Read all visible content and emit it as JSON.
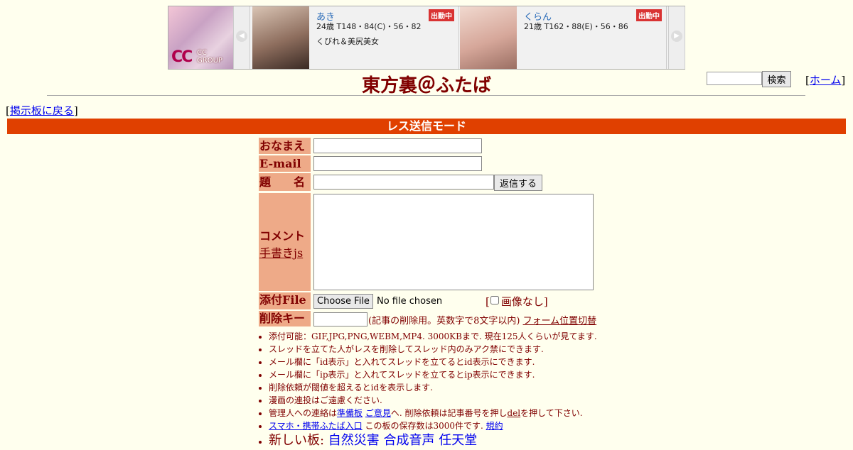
{
  "ad": {
    "logo_text": "CC GROUP",
    "cards": [
      {
        "name": "あき",
        "stats": "24歳 T148・84(C)・56・82",
        "desc": "くびれ＆美尻美女",
        "badge": "出勤中"
      },
      {
        "name": "くらん",
        "stats": "21歳 T162・88(E)・56・86",
        "desc": "",
        "badge": "出勤中"
      }
    ]
  },
  "header": {
    "title": "東方裏＠ふたば",
    "search_button": "検索",
    "home_link": "ホーム",
    "back_link": "掲示板に戻る"
  },
  "mode_bar": "レス送信モード",
  "form": {
    "name_label": "おなまえ",
    "email_label": "E-mail",
    "subject_label": "題　　名",
    "reply_button": "返信する",
    "comment_label": "コメント",
    "handwrite_link": "手書きjs",
    "file_label": "添付File",
    "choose_button": "Choose File",
    "no_file": "No file chosen",
    "no_image": "画像なし",
    "delkey_label": "削除キー",
    "delkey_note": "(記事の削除用。英数字で8文字以内)",
    "form_switch": "フォーム位置切替"
  },
  "notes": {
    "n1": "添付可能：GIF,JPG,PNG,WEBM,MP4. 3000KBまで. 現在125人くらいが見てます.",
    "n2": "スレッドを立てた人がレスを削除してスレッド内のみアク禁にできます.",
    "n3": "メール欄に「id表示」と入れてスレッドを立てるとid表示にできます.",
    "n4": "メール欄に「ip表示」と入れてスレッドを立てるとip表示にできます.",
    "n5": "削除依頼が閾値を超えるとidを表示します.",
    "n6": "漫画の連投はご遠慮ください.",
    "n7_pre": "管理人への連絡は",
    "n7_link1": "準備板",
    "n7_link2": "ご意見",
    "n7_mid": "へ. 削除依頼は記事番号を押し",
    "n7_del": "del",
    "n7_post": "を押して下さい.",
    "n8_link": "スマホ・携帯ふたば入口",
    "n8_mid": " この板の保存数は3000件です. ",
    "n8_rule": "規約",
    "n9_label": "新しい板: ",
    "n9_boards": [
      "自然災害",
      "合成音声",
      "任天堂"
    ]
  }
}
